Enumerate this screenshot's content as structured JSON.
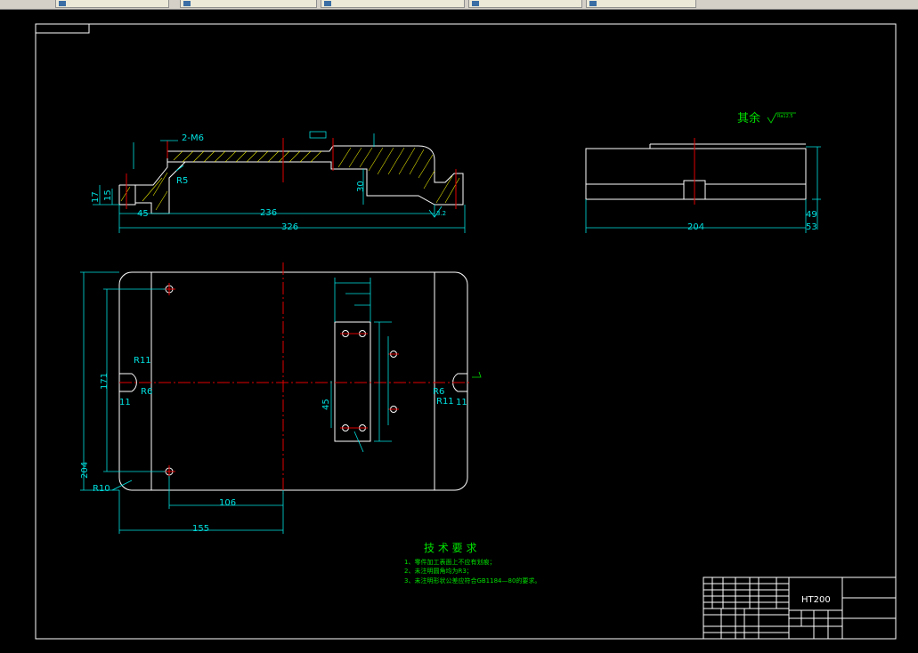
{
  "tabs": [
    "",
    "",
    "",
    "",
    ""
  ],
  "title_block": {
    "material": "HT200"
  },
  "drawing": {
    "surface_note": "其余",
    "surface_symbol": "Ra12.5",
    "annotations": {
      "thread": "2-M6",
      "r5": "R5",
      "r11_left": "R11",
      "r6_left": "R6",
      "r6_right": "R6",
      "r11_right": "R11",
      "r10": "R10"
    },
    "section_dims": {
      "d17": "17",
      "d15": "15",
      "d45": "45",
      "d236": "236",
      "d326": "326",
      "d30": "30",
      "d32": "3.2"
    },
    "side_dims": {
      "d204": "204",
      "d49": "49",
      "d53": "53"
    },
    "plan_dims": {
      "d171": "171",
      "d11_left": "11",
      "d11_right": "11",
      "d45": "45",
      "d204": "204",
      "d106": "106",
      "d155": "155"
    }
  },
  "tech_requirements": {
    "heading": "技 术 要 求",
    "items": [
      "1、零件加工表面上不应有划痕；",
      "2、未注明圆角均为R3；",
      "3、未注明形状公差应符合GB1184—80的要求。"
    ]
  }
}
